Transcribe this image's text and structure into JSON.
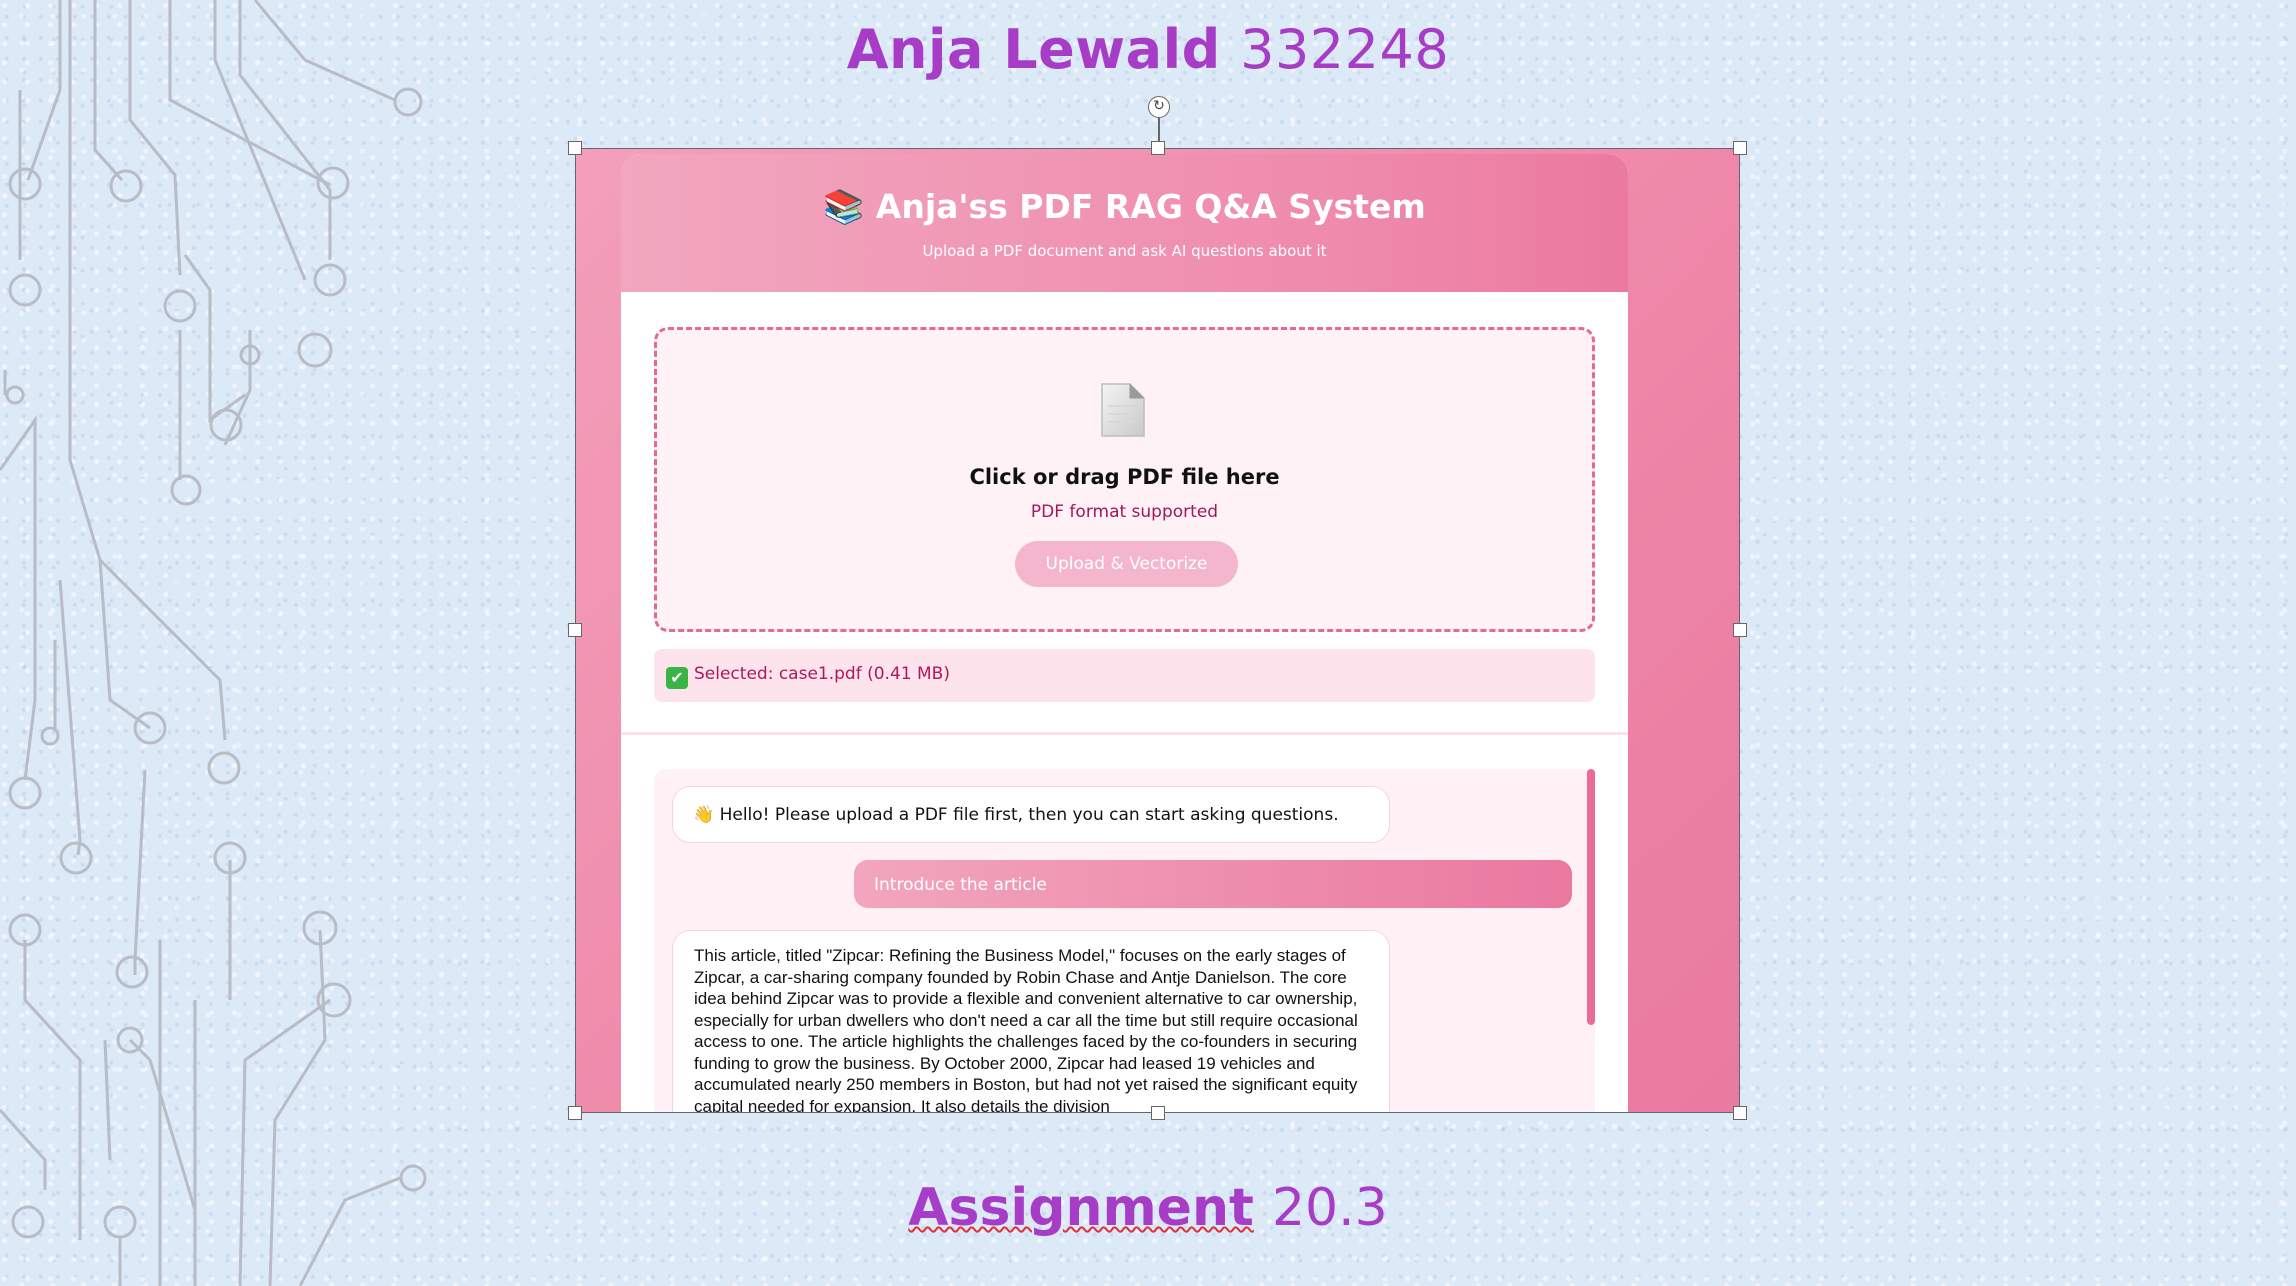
{
  "slide": {
    "title_name": "Anja Lewald",
    "title_id": "332248",
    "footer_word": "Assignment",
    "footer_num": "20.3"
  },
  "app": {
    "title": "📚 Anja'ss PDF RAG Q&A System",
    "subtitle": "Upload a PDF document and ask AI questions about it",
    "upload": {
      "title": "Click or drag PDF file here",
      "hint": "PDF format supported",
      "button_label": "Upload & Vectorize"
    },
    "file_status": {
      "check_glyph": "✔",
      "text": "Selected: case1.pdf (0.41 MB)"
    },
    "chat": {
      "greeting": "👋 Hello! Please upload a PDF file first, then you can start asking questions.",
      "user_message": "Introduce the article",
      "answer": "This article, titled \"Zipcar: Refining the Business Model,\" focuses on the early stages of Zipcar, a car-sharing company founded by Robin Chase and Antje Danielson. The core idea behind Zipcar was to provide a flexible and convenient alternative to car ownership, especially for urban dwellers who don't need a car all the time but still require occasional access to one. The article highlights the challenges faced by the co-founders in securing funding to grow the business. By October 2000, Zipcar had leased 19 vehicles and accumulated nearly 250 members in Boston, but had not yet raised the significant equity capital needed for expansion. It also details the division"
    }
  },
  "colors": {
    "title_purple": "#a73dc7",
    "pink_accent": "#ea6b96",
    "status_text": "#b0165e"
  }
}
